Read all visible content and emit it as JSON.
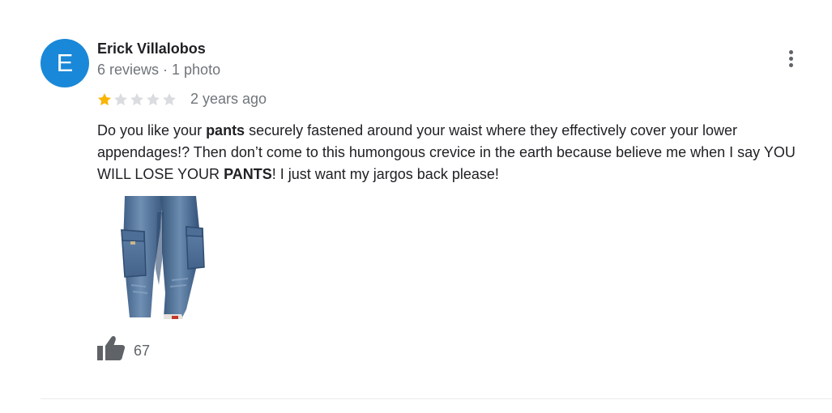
{
  "review": {
    "author": {
      "initial": "E",
      "name": "Erick Villalobos",
      "meta": "6 reviews · 1 photo",
      "avatar_color": "#1a88d8"
    },
    "rating": {
      "value": 1,
      "max": 5,
      "filled_color": "#f9b501",
      "empty_color": "#dadce0"
    },
    "time": "2 years ago",
    "text": {
      "part1": "Do you like your ",
      "bold1": "pants",
      "part2": " securely fastened around your waist where they effectively cover your lower appendages!? Then don’t come to this humongous crevice in the earth because believe me when I say YOU WILL LOSE YOUR ",
      "bold2": "PANTS",
      "part3": "! I just want my jargos back please!"
    },
    "photo": {
      "icon": "cargo-jeans-photo"
    },
    "likes": {
      "count": "67",
      "icon": "thumbs-up-icon"
    },
    "menu_icon": "more-vert-icon"
  }
}
